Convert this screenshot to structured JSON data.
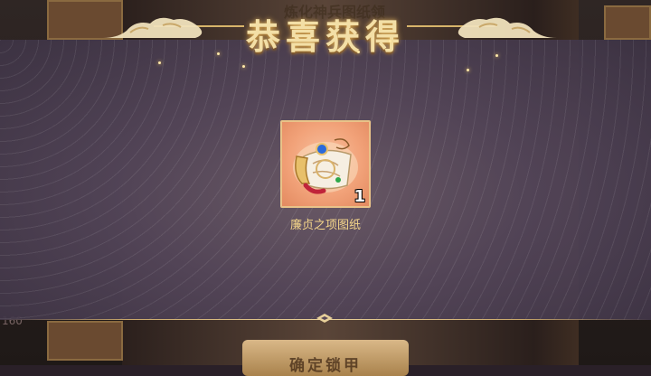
{
  "banner": {
    "title": "恭喜获得"
  },
  "reward": {
    "item_name": "廉贞之项图纸",
    "quantity": "1",
    "icon": "blueprint-scroll-icon"
  },
  "background": {
    "title_partial": "炼化神兵图纸领",
    "counter_partial": "160",
    "confirm_label_partial": "确定锁甲"
  },
  "colors": {
    "gold": "#f3dfa6",
    "item_name": "#f5d68a",
    "item_bg": "#f2a37a"
  }
}
